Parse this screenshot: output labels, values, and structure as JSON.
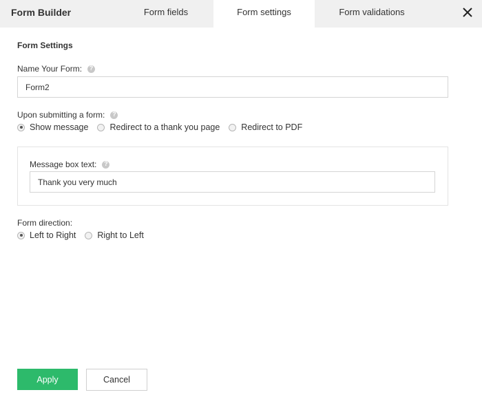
{
  "header": {
    "title": "Form Builder",
    "tabs": [
      {
        "label": "Form fields",
        "active": false
      },
      {
        "label": "Form settings",
        "active": true
      },
      {
        "label": "Form validations",
        "active": false
      }
    ],
    "close_icon": "close-icon"
  },
  "settings": {
    "section_title": "Form Settings",
    "form_name": {
      "label": "Name Your Form:",
      "value": "Form2"
    },
    "on_submit": {
      "label": "Upon submitting a form:",
      "options": [
        {
          "label": "Show message",
          "checked": true
        },
        {
          "label": "Redirect to a thank you page",
          "checked": false
        },
        {
          "label": "Redirect to PDF",
          "checked": false
        }
      ]
    },
    "message_box": {
      "label": "Message box text:",
      "value": "Thank you very much"
    },
    "direction": {
      "label": "Form direction:",
      "options": [
        {
          "label": "Left to Right",
          "checked": true
        },
        {
          "label": "Right to Left",
          "checked": false
        }
      ]
    }
  },
  "footer": {
    "apply_label": "Apply",
    "cancel_label": "Cancel"
  },
  "colors": {
    "header_bg": "#f0f0f0",
    "apply_bg": "#2dba6b",
    "help_icon": "#c8c8c8"
  }
}
